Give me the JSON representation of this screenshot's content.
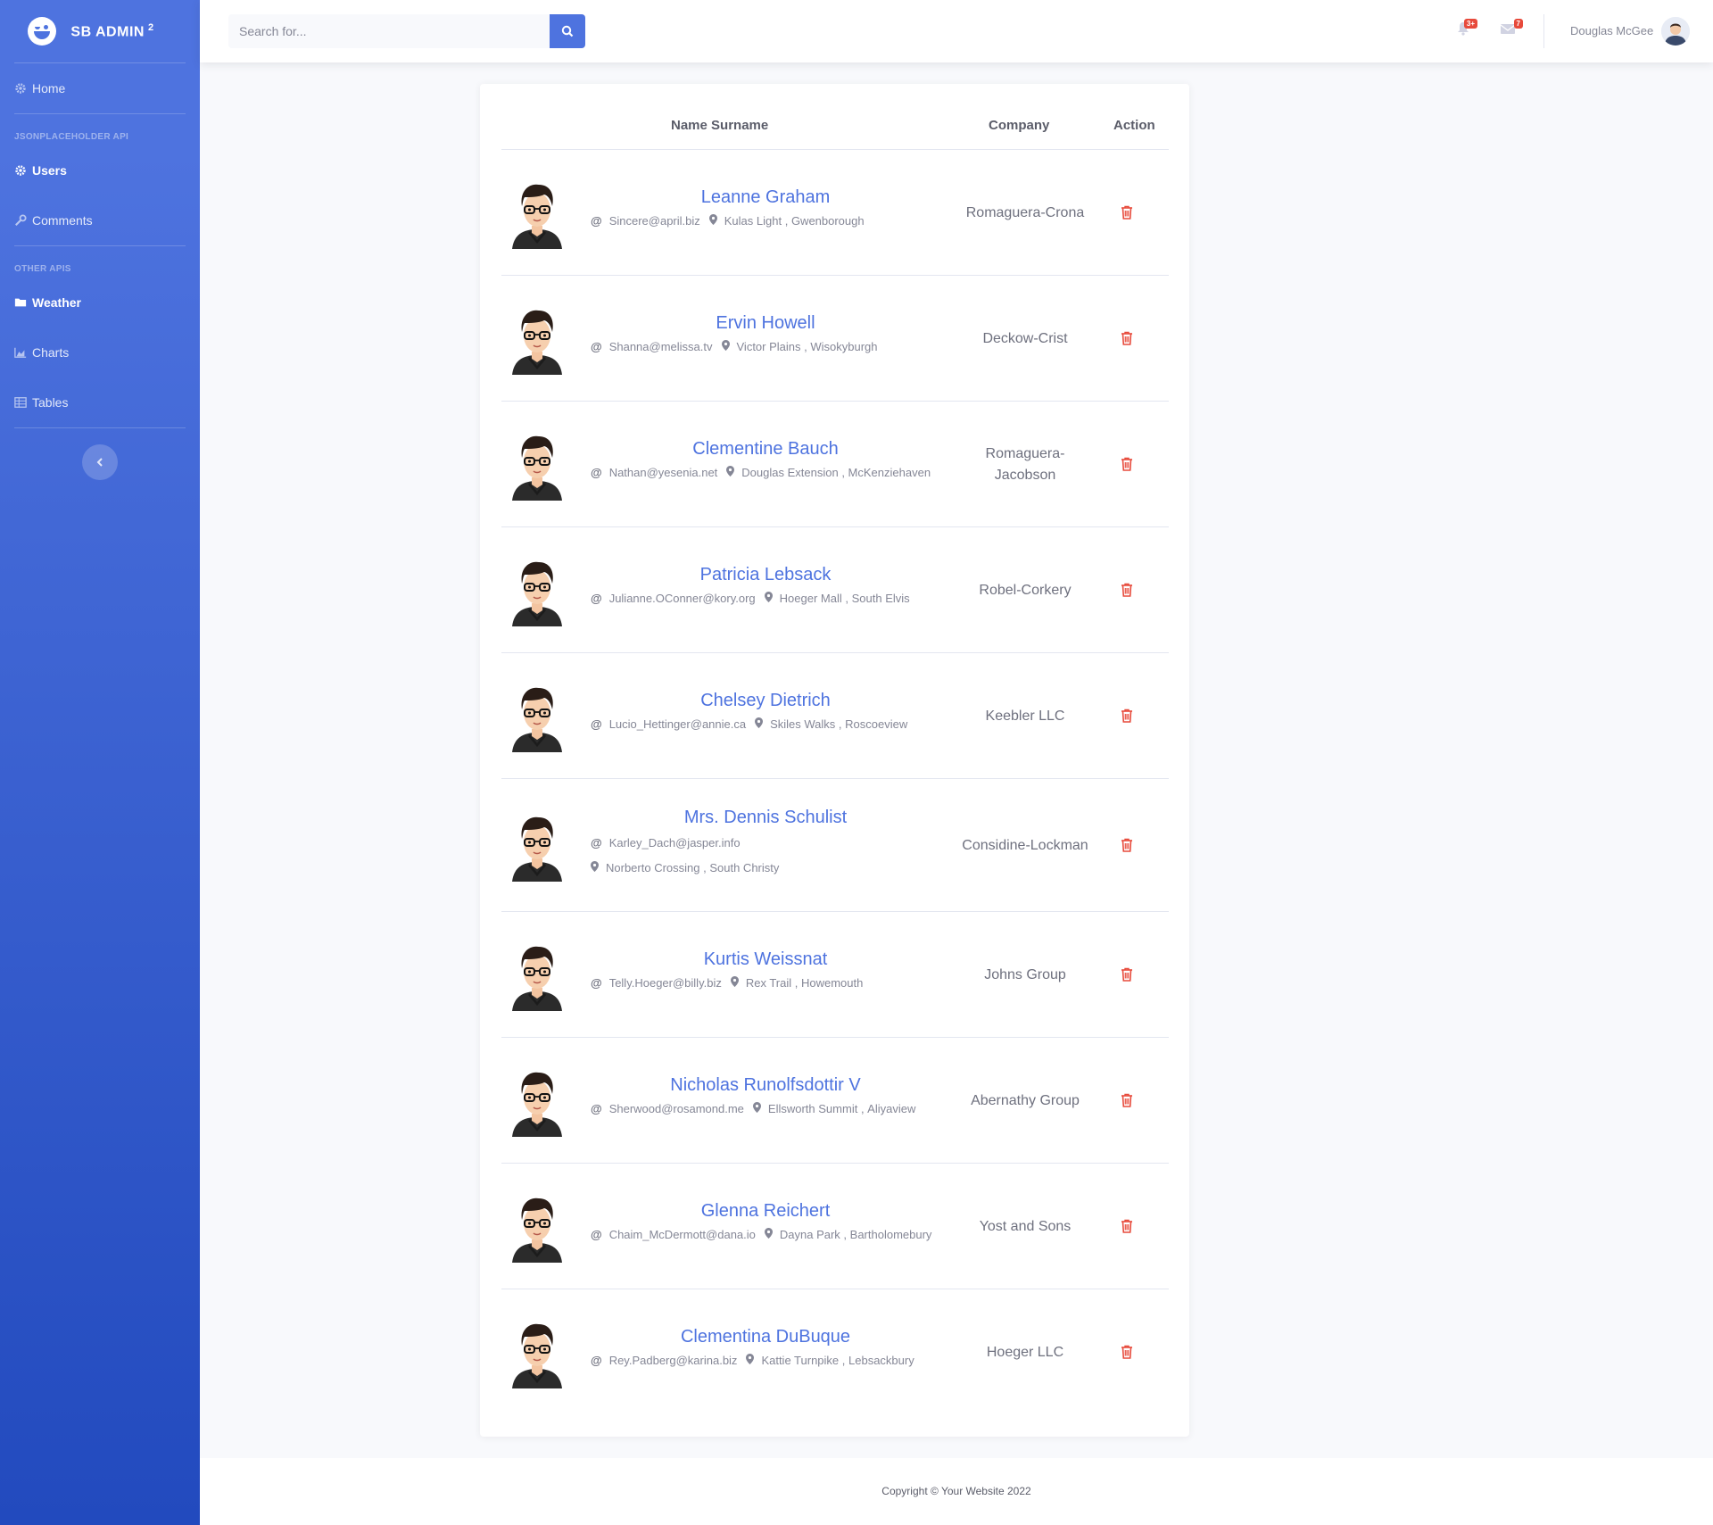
{
  "brand": {
    "name": "SB ADMIN",
    "sup": "2"
  },
  "sidebar": {
    "home": "Home",
    "heading1": "JSONPLACEHOLDER API",
    "users": "Users",
    "comments": "Comments",
    "heading2": "OTHER APIS",
    "weather": "Weather",
    "charts": "Charts",
    "tables": "Tables"
  },
  "topbar": {
    "search_placeholder": "Search for...",
    "alerts_badge": "3+",
    "messages_badge": "7",
    "user_name": "Douglas McGee"
  },
  "table": {
    "headers": {
      "name": "Name Surname",
      "company": "Company",
      "action": "Action"
    },
    "rows": [
      {
        "name": "Leanne Graham",
        "email": "Sincere@april.biz",
        "street": "Kulas Light",
        "city": "Gwenborough",
        "company": "Romaguera-Crona"
      },
      {
        "name": "Ervin Howell",
        "email": "Shanna@melissa.tv",
        "street": "Victor Plains",
        "city": "Wisokyburgh",
        "company": "Deckow-Crist"
      },
      {
        "name": "Clementine Bauch",
        "email": "Nathan@yesenia.net",
        "street": "Douglas Extension",
        "city": "McKenziehaven",
        "company": "Romaguera-Jacobson"
      },
      {
        "name": "Patricia Lebsack",
        "email": "Julianne.OConner@kory.org",
        "street": "Hoeger Mall",
        "city": "South Elvis",
        "company": "Robel-Corkery"
      },
      {
        "name": "Chelsey Dietrich",
        "email": "Lucio_Hettinger@annie.ca",
        "street": "Skiles Walks",
        "city": "Roscoeview",
        "company": "Keebler LLC"
      },
      {
        "name": "Mrs. Dennis Schulist",
        "email": "Karley_Dach@jasper.info",
        "street": "Norberto Crossing",
        "city": "South Christy",
        "company": "Considine-Lockman"
      },
      {
        "name": "Kurtis Weissnat",
        "email": "Telly.Hoeger@billy.biz",
        "street": "Rex Trail",
        "city": "Howemouth",
        "company": "Johns Group"
      },
      {
        "name": "Nicholas Runolfsdottir V",
        "email": "Sherwood@rosamond.me",
        "street": "Ellsworth Summit",
        "city": "Aliyaview",
        "company": "Abernathy Group"
      },
      {
        "name": "Glenna Reichert",
        "email": "Chaim_McDermott@dana.io",
        "street": "Dayna Park",
        "city": "Bartholomebury",
        "company": "Yost and Sons"
      },
      {
        "name": "Clementina DuBuque",
        "email": "Rey.Padberg@karina.biz",
        "street": "Kattie Turnpike",
        "city": "Lebsackbury",
        "company": "Hoeger LLC"
      }
    ]
  },
  "footer": {
    "text": "Copyright © Your Website 2022"
  },
  "colors": {
    "primary": "#4e73df",
    "danger": "#e74a3b",
    "text": "#858796"
  }
}
